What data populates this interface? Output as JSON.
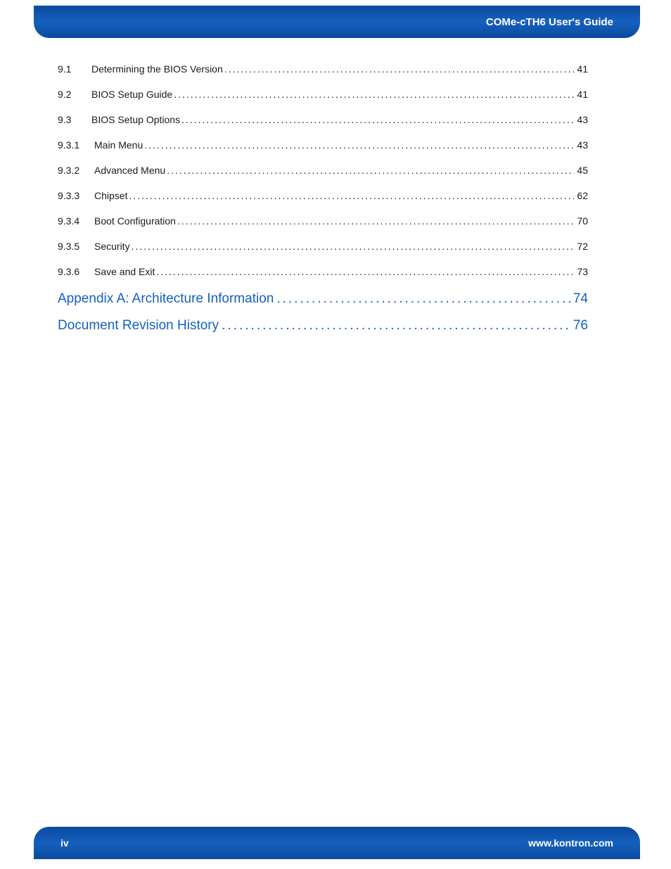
{
  "header": {
    "title": "COMe-cTH6 User's Guide"
  },
  "toc": {
    "minor": [
      {
        "num": "9.1",
        "title": "Determining the BIOS Version",
        "page": "41"
      },
      {
        "num": "9.2",
        "title": "BIOS Setup Guide",
        "page": "41"
      },
      {
        "num": "9.3",
        "title": "BIOS Setup Options",
        "page": "43"
      },
      {
        "num": "9.3.1",
        "title": "Main Menu",
        "page": "43"
      },
      {
        "num": "9.3.2",
        "title": "Advanced Menu",
        "page": "45"
      },
      {
        "num": "9.3.3",
        "title": "Chipset",
        "page": "62"
      },
      {
        "num": "9.3.4",
        "title": "Boot Configuration",
        "page": "70"
      },
      {
        "num": "9.3.5",
        "title": "Security",
        "page": "72"
      },
      {
        "num": "9.3.6",
        "title": "Save and Exit",
        "page": "73"
      }
    ],
    "major": [
      {
        "title": "Appendix A: Architecture Information",
        "page": "74"
      },
      {
        "title": "Document Revision History",
        "page": "76"
      }
    ]
  },
  "footer": {
    "pageNum": "iv",
    "url": "www.kontron.com"
  }
}
